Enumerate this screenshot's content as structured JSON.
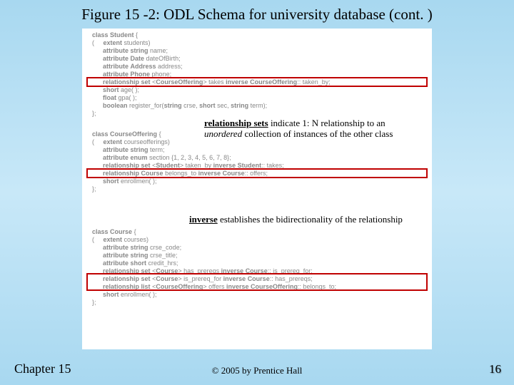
{
  "title": "Figure 15 -2: ODL Schema for university database (cont. )",
  "code": {
    "student": [
      "class Student {",
      "(     extent students)",
      "      attribute string name;",
      "      attribute Date dateOfBirth;",
      "      attribute Address address;",
      "      attribute Phone phone;",
      "      relationship set <CourseOffering> takes inverse CourseOffering:: taken_by;",
      "      short age( );",
      "      float gpa( );",
      "      boolean register_for(string crse, short sec, string term);",
      "};"
    ],
    "courseoffering": [
      "class CourseOffering {",
      "(     extent courseofferings)",
      "      attribute string term;",
      "      attribute enum section {1, 2, 3, 4, 5, 6, 7, 8};",
      "      relationship set <Student> taken_by inverse Student:: takes;",
      "      relationship Course belongs_to inverse Course:: offers;",
      "      short enrollmen( );",
      "};"
    ],
    "course": [
      "class Course {",
      "(     extent courses)",
      "      attribute string crse_code;",
      "      attribute string crse_title;",
      "      attribute short credit_hrs;",
      "      relationship set <Course> has_prereqs inverse Course:: is_prereq_for;",
      "      relationship set <Course> is_prereq_for inverse Course:: has_prereqs;",
      "      relationship list <CourseOffering> offers inverse CourseOffering:: belongs_to;",
      "      short enrollmen( );",
      "};"
    ]
  },
  "annotations": {
    "rel_sets_bold": "relationship sets",
    "rel_sets_rest_1": " indicate 1: N relationship to an ",
    "rel_sets_em": "unordered",
    "rel_sets_rest_2": " collection of instances of the other class",
    "inverse_bold": "inverse",
    "inverse_rest": " establishes the bidirectionality of the relationship"
  },
  "footer": {
    "chapter": "Chapter 15",
    "copyright": "© 2005 by Prentice Hall",
    "page": "16"
  }
}
